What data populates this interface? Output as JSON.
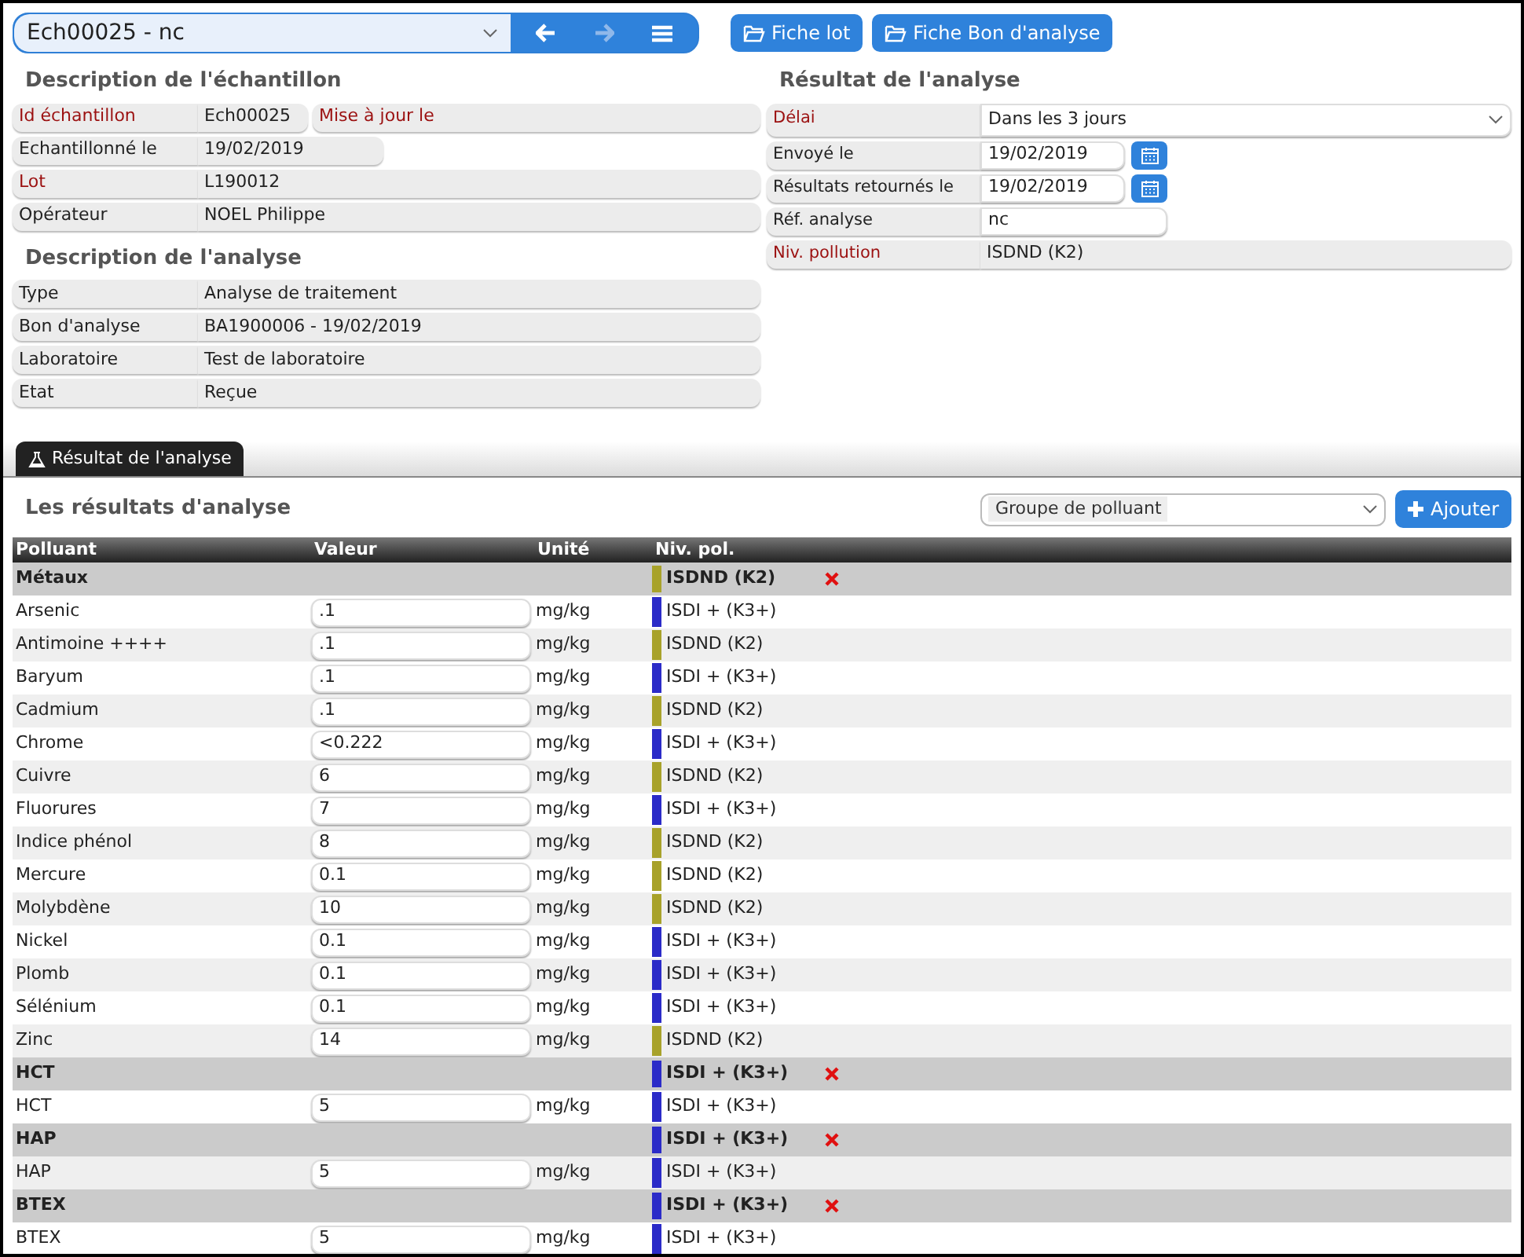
{
  "record_select": {
    "value": "Ech00025 - nc"
  },
  "toolbar_buttons": [
    {
      "label": "Fiche lot"
    },
    {
      "label": "Fiche Bon d'analyse"
    }
  ],
  "sample_description": {
    "title": "Description de l'échantillon",
    "fields": [
      {
        "kind": "split",
        "label": "Id échantillon",
        "required": true,
        "value": "Ech00025",
        "extra_label": "Mise à jour le"
      },
      {
        "kind": "short",
        "label": "Echantillonné le",
        "required": false,
        "value": "19/02/2019"
      },
      {
        "kind": "full",
        "label": "Lot",
        "required": true,
        "value": "L190012"
      },
      {
        "kind": "full",
        "label": "Opérateur",
        "required": false,
        "value": "NOEL Philippe"
      }
    ]
  },
  "analysis_description": {
    "title": "Description de l'analyse",
    "fields": [
      {
        "kind": "full",
        "label": "Type",
        "required": false,
        "value": "Analyse de traitement"
      },
      {
        "kind": "full",
        "label": "Bon d'analyse",
        "required": false,
        "value": "BA1900006 - 19/02/2019"
      },
      {
        "kind": "full",
        "label": "Laboratoire",
        "required": false,
        "value": "Test de laboratoire"
      },
      {
        "kind": "full",
        "label": "Etat",
        "required": false,
        "value": "Reçue"
      }
    ]
  },
  "analysis_result": {
    "title": "Résultat de l'analyse",
    "fields": [
      {
        "kind": "select",
        "label": "Délai",
        "required": true,
        "value": "Dans les 3 jours"
      },
      {
        "kind": "date",
        "label": "Envoyé le",
        "required": false,
        "value": "19/02/2019"
      },
      {
        "kind": "date",
        "label": "Résultats retournés le",
        "required": false,
        "value": "19/02/2019"
      },
      {
        "kind": "text",
        "label": "Réf. analyse",
        "required": false,
        "value": "nc"
      },
      {
        "kind": "full",
        "label": "Niv. pollution",
        "required": true,
        "value": "ISDND (K2)"
      }
    ]
  },
  "tabs": [
    {
      "label": "Résultat de l'analyse",
      "selected": true
    }
  ],
  "results": {
    "title": "Les résultats d'analyse",
    "group_select": {
      "placeholder": "Groupe de polluant"
    },
    "add_button": "Ajouter",
    "columns": [
      "Polluant",
      "Valeur",
      "Unité",
      "Niv. pol."
    ],
    "groups": [
      {
        "name": "Métaux",
        "level": "ISDND (K2)",
        "color": "#a8a22a",
        "rows": [
          {
            "pollutant": "Arsenic",
            "value": ".1",
            "unit": "mg/kg",
            "level": "ISDI + (K3+)",
            "color": "#2b2bc8"
          },
          {
            "pollutant": "Antimoine ++++",
            "value": ".1",
            "unit": "mg/kg",
            "level": "ISDND (K2)",
            "color": "#a8a22a"
          },
          {
            "pollutant": "Baryum",
            "value": ".1",
            "unit": "mg/kg",
            "level": "ISDI + (K3+)",
            "color": "#2b2bc8"
          },
          {
            "pollutant": "Cadmium",
            "value": ".1",
            "unit": "mg/kg",
            "level": "ISDND (K2)",
            "color": "#a8a22a"
          },
          {
            "pollutant": "Chrome",
            "value": "<0.222",
            "unit": "mg/kg",
            "level": "ISDI + (K3+)",
            "color": "#2b2bc8"
          },
          {
            "pollutant": "Cuivre",
            "value": "6",
            "unit": "mg/kg",
            "level": "ISDND (K2)",
            "color": "#a8a22a"
          },
          {
            "pollutant": "Fluorures",
            "value": "7",
            "unit": "mg/kg",
            "level": "ISDI + (K3+)",
            "color": "#2b2bc8"
          },
          {
            "pollutant": "Indice phénol",
            "value": "8",
            "unit": "mg/kg",
            "level": "ISDND (K2)",
            "color": "#a8a22a"
          },
          {
            "pollutant": "Mercure",
            "value": "0.1",
            "unit": "mg/kg",
            "level": "ISDND (K2)",
            "color": "#a8a22a"
          },
          {
            "pollutant": "Molybdène",
            "value": "10",
            "unit": "mg/kg",
            "level": "ISDND (K2)",
            "color": "#a8a22a"
          },
          {
            "pollutant": "Nickel",
            "value": "0.1",
            "unit": "mg/kg",
            "level": "ISDI + (K3+)",
            "color": "#2b2bc8"
          },
          {
            "pollutant": "Plomb",
            "value": "0.1",
            "unit": "mg/kg",
            "level": "ISDI + (K3+)",
            "color": "#2b2bc8"
          },
          {
            "pollutant": "Sélénium",
            "value": "0.1",
            "unit": "mg/kg",
            "level": "ISDI + (K3+)",
            "color": "#2b2bc8"
          },
          {
            "pollutant": "Zinc",
            "value": "14",
            "unit": "mg/kg",
            "level": "ISDND (K2)",
            "color": "#a8a22a"
          }
        ]
      },
      {
        "name": "HCT",
        "level": "ISDI + (K3+)",
        "color": "#2b2bc8",
        "rows": [
          {
            "pollutant": "HCT",
            "value": "5",
            "unit": "mg/kg",
            "level": "ISDI + (K3+)",
            "color": "#2b2bc8"
          }
        ]
      },
      {
        "name": "HAP",
        "level": "ISDI + (K3+)",
        "color": "#2b2bc8",
        "rows": [
          {
            "pollutant": "HAP",
            "value": "5",
            "unit": "mg/kg",
            "level": "ISDI + (K3+)",
            "color": "#2b2bc8"
          }
        ]
      },
      {
        "name": "BTEX",
        "level": "ISDI + (K3+)",
        "color": "#2b2bc8",
        "rows": [
          {
            "pollutant": "BTEX",
            "value": "5",
            "unit": "mg/kg",
            "level": "ISDI + (K3+)",
            "color": "#2b2bc8"
          }
        ]
      }
    ]
  }
}
